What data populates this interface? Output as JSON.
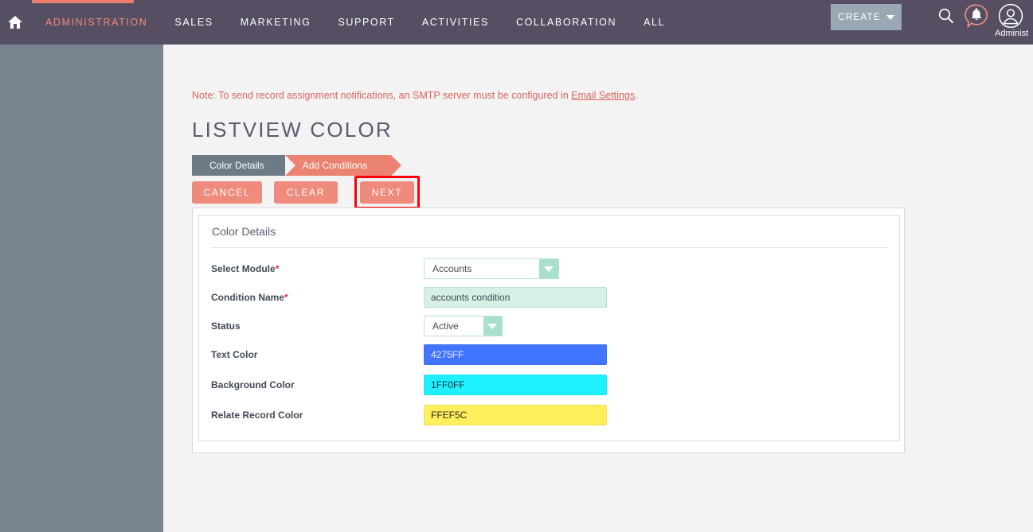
{
  "topbar": {
    "home_icon": "home-icon",
    "nav": [
      {
        "label": "ADMINISTRATION",
        "active": true
      },
      {
        "label": "SALES",
        "active": false
      },
      {
        "label": "MARKETING",
        "active": false
      },
      {
        "label": "SUPPORT",
        "active": false
      },
      {
        "label": "ACTIVITIES",
        "active": false
      },
      {
        "label": "COLLABORATION",
        "active": false
      },
      {
        "label": "ALL",
        "active": false
      }
    ],
    "create_label": "CREATE",
    "search_icon": "search-icon",
    "bell_icon": "notification-bell-icon",
    "avatar_icon": "user-avatar-icon",
    "user_name": "Administ",
    "accent_color": "#ee7e6c",
    "bar_color": "#564f63"
  },
  "sidebar": {
    "collapse_icon": "collapse-left-icon",
    "bg_color": "#78848f"
  },
  "main": {
    "note_prefix": "Note: To send record assignment notifications, an SMTP server must be configured in ",
    "note_link": "Email Settings",
    "note_suffix": ".",
    "page_title": "LISTVIEW COLOR",
    "steps": [
      {
        "label": "Color Details",
        "state": "done"
      },
      {
        "label": "Add Conditions",
        "state": "current"
      }
    ],
    "buttons": {
      "cancel": "CANCEL",
      "clear": "CLEAR",
      "next": "NEXT",
      "highlight_color": "#ff0000"
    },
    "card_title": "Color Details",
    "fields": [
      {
        "label": "Select Module",
        "required": true,
        "type": "select",
        "value": "Accounts"
      },
      {
        "label": "Condition Name",
        "required": true,
        "type": "text",
        "value": "accounts condition"
      },
      {
        "label": "Status",
        "required": false,
        "type": "select",
        "value": "Active"
      },
      {
        "label": "Text Color",
        "required": false,
        "type": "color",
        "value": "4275FF",
        "swatch": "#4275FF",
        "text_color": "#e8e8ff"
      },
      {
        "label": "Background Color",
        "required": false,
        "type": "color",
        "value": "1FF0FF",
        "swatch": "#1FF0FF",
        "text_color": "#14303a"
      },
      {
        "label": "Relate Record Color",
        "required": false,
        "type": "color",
        "value": "FFEF5C",
        "swatch": "#FFEF5C",
        "text_color": "#2b2b18"
      }
    ]
  }
}
